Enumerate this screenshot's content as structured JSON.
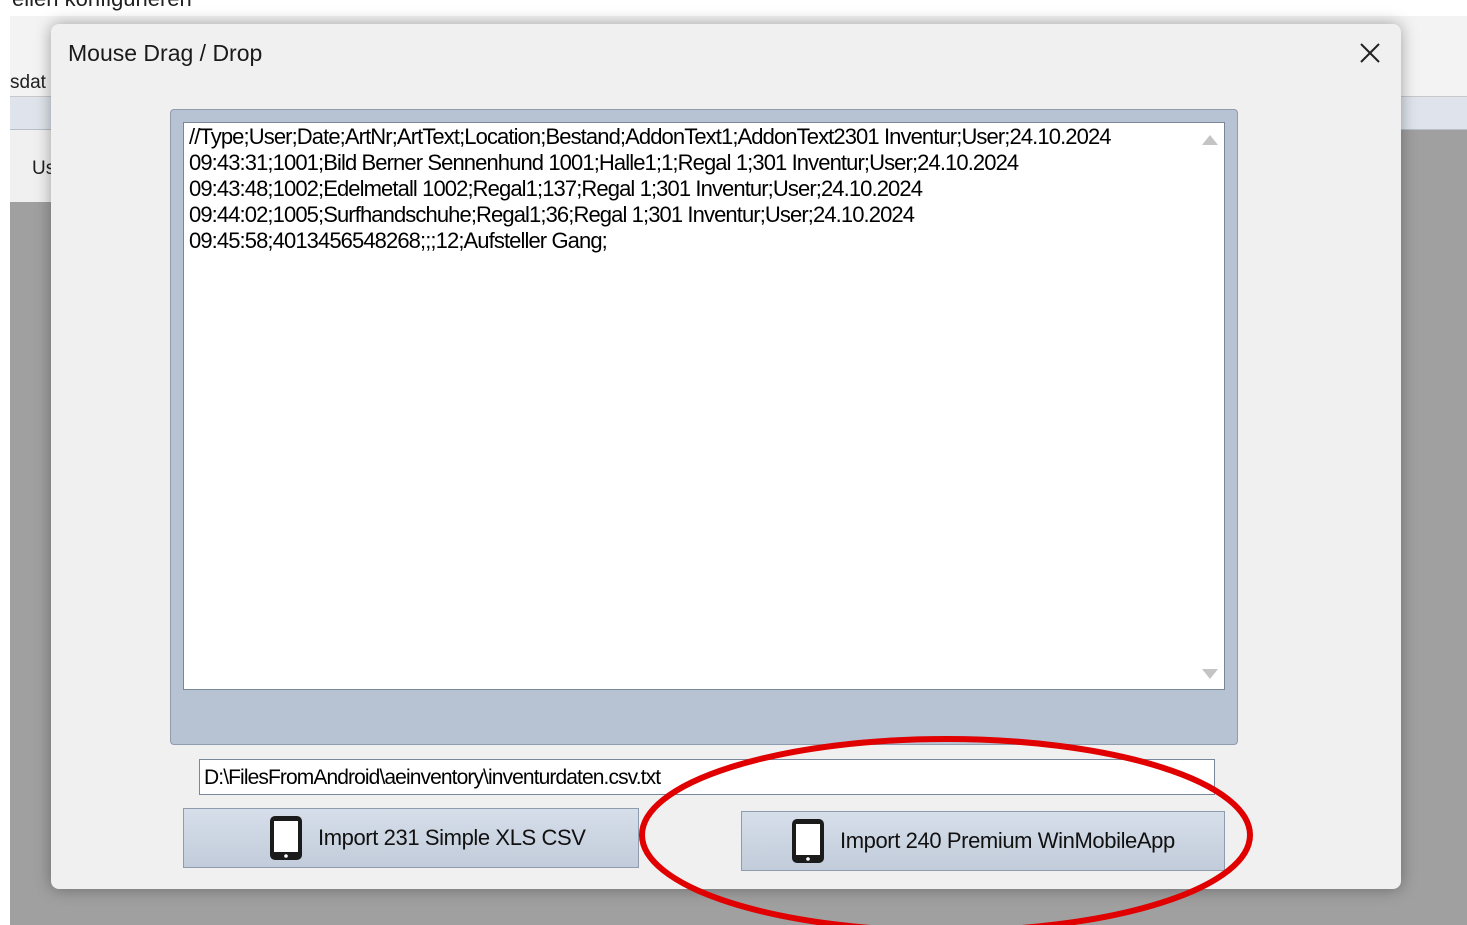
{
  "background_app": {
    "title": "eilen konfigurieren",
    "toolbar_text": "sdat",
    "panel_text": "Us"
  },
  "dialog": {
    "title": "Mouse Drag / Drop",
    "close_icon": "close-icon",
    "text_lines": [
      "//Type;User;Date;ArtNr;ArtText;Location;Bestand;AddonText1;AddonText2301 Inventur;User;24.10.2024",
      "09:43:31;1001;Bild Berner Sennenhund 1001;Halle1;1;Regal 1;301 Inventur;User;24.10.2024",
      "09:43:48;1002;Edelmetall 1002;Regal1;137;Regal 1;301 Inventur;User;24.10.2024",
      "09:44:02;1005;Surfhandschuhe;Regal1;36;Regal 1;301 Inventur;User;24.10.2024",
      "09:45:58;4013456548268;;;12;Aufsteller Gang;"
    ],
    "file_path": "D:\\FilesFromAndroid\\aeinventory\\inventurdaten.csv.txt",
    "buttons": {
      "import_231": {
        "label": "Import 231 Simple XLS CSV",
        "icon": "tablet-icon"
      },
      "import_240": {
        "label": "Import 240 Premium WinMobileApp",
        "icon": "tablet-icon"
      }
    }
  },
  "annotation": {
    "color": "#e00000",
    "shape": "ellipse"
  }
}
